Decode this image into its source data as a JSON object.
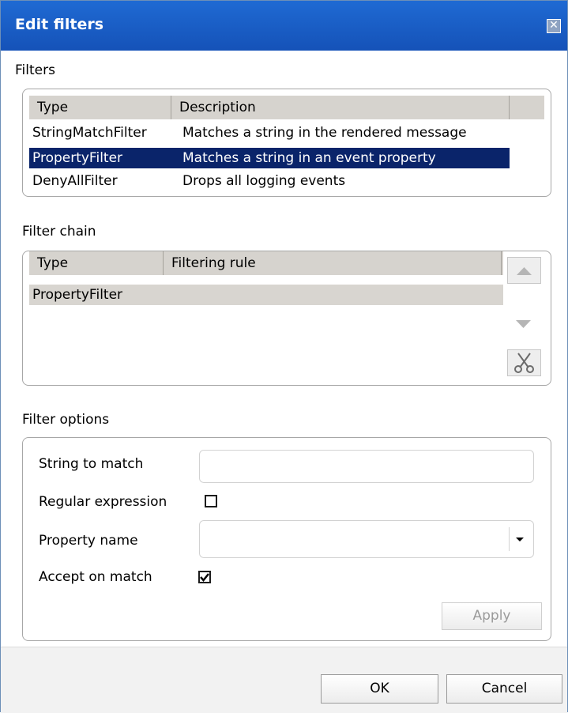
{
  "dialog": {
    "title": "Edit filters",
    "close_label": "✕"
  },
  "filters": {
    "section_label": "Filters",
    "columns": [
      "Type",
      "Description"
    ],
    "rows": [
      {
        "type": "StringMatchFilter",
        "description": "Matches a string in the rendered message"
      },
      {
        "type": "PropertyFilter",
        "description": "Matches a string in an event property"
      },
      {
        "type": "DenyAllFilter",
        "description": "Drops all logging events"
      }
    ],
    "selected_row": 1
  },
  "filter_chain": {
    "section_label": "Filter chain",
    "columns": [
      "Type",
      "Filtering rule"
    ],
    "rows": [
      {
        "type": "PropertyFilter",
        "rule": ""
      }
    ],
    "buttons": {
      "move_up_icon": "triangle-up-icon",
      "move_down_icon": "triangle-down-icon",
      "remove_icon": "scissors-icon"
    }
  },
  "filter_options": {
    "section_label": "Filter options",
    "string_to_match_label": "String to match",
    "string_to_match_value": "",
    "regex_label": "Regular expression",
    "regex_checked": false,
    "property_name_label": "Property name",
    "property_name_value": "",
    "accept_label": "Accept on match",
    "accept_checked": true,
    "apply_label": "Apply"
  },
  "footer": {
    "ok_label": "OK",
    "cancel_label": "Cancel"
  },
  "colors": {
    "titlebar": "#1a5fc8",
    "selection": "#0a246a",
    "header": "#d6d3ce"
  }
}
